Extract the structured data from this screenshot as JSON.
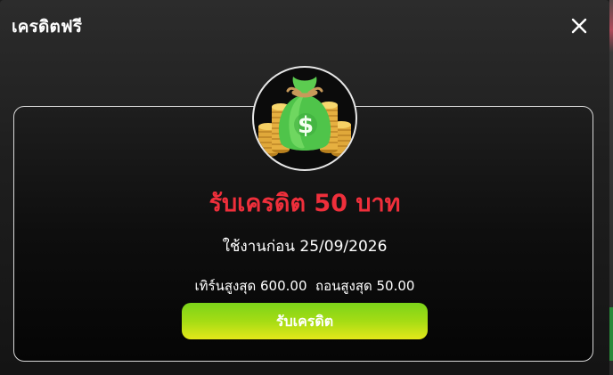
{
  "modal": {
    "title": "เครดิตฟรี",
    "close_icon": "close-icon"
  },
  "promo": {
    "icon": "money-bag-icon",
    "headline": "รับเครดิต 50 บาท",
    "usage_text": "ใช้งานก่อน 25/09/2026",
    "limits_text": "เทิร์นสูงสุด 600.00  ถอนสูงสุด 50.00",
    "claim_label": "รับเครดิต"
  },
  "colors": {
    "headline": "#ef2f3b",
    "button_top": "#7cd41a",
    "button_bottom": "#e4e81a"
  }
}
